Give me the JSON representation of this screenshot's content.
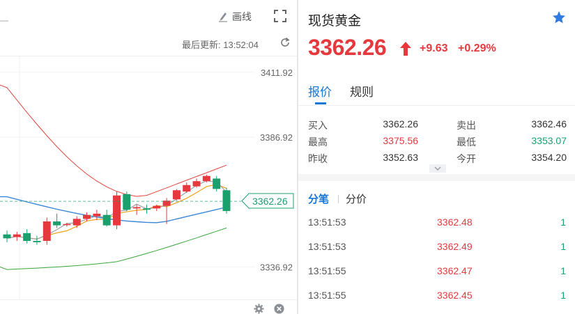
{
  "toolbar": {
    "draw_label": "画线"
  },
  "chart": {
    "updated_label": "最后更新:",
    "updated_time": "13:52:04",
    "price_tag": "3362.26",
    "colors": {
      "up": "#e6393e",
      "down": "#1aa06d",
      "ma_fast": "#9aa0a6",
      "ma_mid": "#f0a21a",
      "ma_slow": "#3a86d9",
      "band_top": "#e0463e",
      "band_bottom": "#3aa63a"
    }
  },
  "chart_data": {
    "type": "candlestick",
    "y_ticks": [
      "3411.92",
      "3386.92",
      "3336.92"
    ],
    "ylim": [
      3330,
      3420
    ],
    "candles": [
      {
        "o": 3349.5,
        "h": 3351.0,
        "l": 3346.5,
        "c": 3348.0
      },
      {
        "o": 3348.5,
        "h": 3350.5,
        "l": 3347.0,
        "c": 3349.5
      },
      {
        "o": 3350.0,
        "h": 3351.5,
        "l": 3346.0,
        "c": 3347.0
      },
      {
        "o": 3347.0,
        "h": 3349.0,
        "l": 3345.5,
        "c": 3346.5
      },
      {
        "o": 3347.0,
        "h": 3356.0,
        "l": 3345.5,
        "c": 3354.5
      },
      {
        "o": 3354.5,
        "h": 3357.5,
        "l": 3352.0,
        "c": 3353.0
      },
      {
        "o": 3353.5,
        "h": 3354.0,
        "l": 3352.5,
        "c": 3353.5
      },
      {
        "o": 3353.0,
        "h": 3356.5,
        "l": 3352.0,
        "c": 3355.5
      },
      {
        "o": 3355.5,
        "h": 3358.0,
        "l": 3354.5,
        "c": 3357.0
      },
      {
        "o": 3356.5,
        "h": 3359.0,
        "l": 3355.0,
        "c": 3357.5
      },
      {
        "o": 3357.0,
        "h": 3359.0,
        "l": 3352.5,
        "c": 3353.0
      },
      {
        "o": 3353.0,
        "h": 3366.0,
        "l": 3351.5,
        "c": 3364.5
      },
      {
        "o": 3365.0,
        "h": 3366.0,
        "l": 3358.5,
        "c": 3359.0
      },
      {
        "o": 3359.5,
        "h": 3361.0,
        "l": 3357.0,
        "c": 3360.0
      },
      {
        "o": 3359.5,
        "h": 3361.0,
        "l": 3357.5,
        "c": 3359.0
      },
      {
        "o": 3359.5,
        "h": 3361.0,
        "l": 3358.5,
        "c": 3360.5
      },
      {
        "o": 3360.5,
        "h": 3363.5,
        "l": 3353.5,
        "c": 3362.5
      },
      {
        "o": 3363.0,
        "h": 3367.0,
        "l": 3362.5,
        "c": 3366.5
      },
      {
        "o": 3366.0,
        "h": 3369.5,
        "l": 3365.5,
        "c": 3368.5
      },
      {
        "o": 3368.0,
        "h": 3371.0,
        "l": 3367.5,
        "c": 3370.0
      },
      {
        "o": 3370.0,
        "h": 3372.5,
        "l": 3369.5,
        "c": 3372.0
      },
      {
        "o": 3371.0,
        "h": 3372.0,
        "l": 3366.0,
        "c": 3367.0
      },
      {
        "o": 3366.5,
        "h": 3367.5,
        "l": 3357.5,
        "c": 3358.5
      }
    ]
  },
  "quote": {
    "title": "现货黄金",
    "price": "3362.26",
    "change": "+9.63",
    "change_pct": "+0.29%",
    "tabs": [
      "报价",
      "规则"
    ],
    "rows": [
      {
        "l1": "买入",
        "v1": "3362.26",
        "l2": "卖出",
        "v2": "3362.46"
      },
      {
        "l1": "最高",
        "v1": "3375.56",
        "l2": "最低",
        "v2": "3353.07"
      },
      {
        "l1": "昨收",
        "v1": "3352.63",
        "l2": "今开",
        "v2": "3354.20"
      }
    ]
  },
  "trades": {
    "tabs": [
      "分笔",
      "分价"
    ],
    "rows": [
      {
        "time": "13:51:53",
        "price": "3362.48",
        "vol": "1"
      },
      {
        "time": "13:51:53",
        "price": "3362.49",
        "vol": "1"
      },
      {
        "time": "13:51:55",
        "price": "3362.47",
        "vol": "1"
      },
      {
        "time": "13:51:55",
        "price": "3362.45",
        "vol": "1"
      }
    ]
  }
}
